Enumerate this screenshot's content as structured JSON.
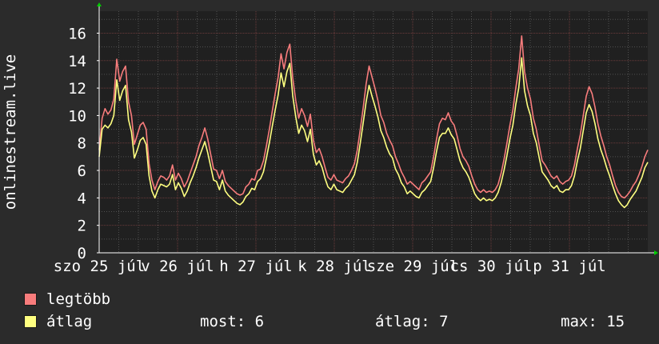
{
  "chart_data": {
    "type": "line",
    "ylabel": "onlinestream.live",
    "ylim": [
      0,
      17.6
    ],
    "yticks": [
      0,
      2,
      4,
      6,
      8,
      10,
      12,
      14,
      16
    ],
    "grid": true,
    "xlabels": [
      "szo 25 júl",
      "v 26 júl",
      "h 27 júl",
      "k 28 júl",
      "sze 29 júl",
      "cs 30 júl",
      "p 31 júl"
    ],
    "days": 7,
    "samples_per_day": 48,
    "series": [
      {
        "name": "legtöbb",
        "color": "#f87c7c",
        "values": [
          7.5,
          9.8,
          10.5,
          10.1,
          10.4,
          11.2,
          14.1,
          12.5,
          13.2,
          13.6,
          11.0,
          10.0,
          7.9,
          8.6,
          9.3,
          9.5,
          9.0,
          6.5,
          5.3,
          4.6,
          5.2,
          5.6,
          5.5,
          5.3,
          5.6,
          6.4,
          5.3,
          5.8,
          5.4,
          4.8,
          5.2,
          5.8,
          6.4,
          7.0,
          7.8,
          8.4,
          9.1,
          8.3,
          7.2,
          6.1,
          6.0,
          5.4,
          6.0,
          5.2,
          4.9,
          4.7,
          4.5,
          4.3,
          4.2,
          4.3,
          4.8,
          5.0,
          5.4,
          5.3,
          6.0,
          6.1,
          6.7,
          7.8,
          9.0,
          10.3,
          11.6,
          12.8,
          14.5,
          13.4,
          14.6,
          15.2,
          12.7,
          11.1,
          9.8,
          10.5,
          10.0,
          9.2,
          10.1,
          8.2,
          7.3,
          7.6,
          7.0,
          6.2,
          5.5,
          5.3,
          5.7,
          5.3,
          5.2,
          5.1,
          5.4,
          5.6,
          6.0,
          6.5,
          7.5,
          9.0,
          10.6,
          12.3,
          13.6,
          12.8,
          12.0,
          11.1,
          10.0,
          9.5,
          8.7,
          8.2,
          7.8,
          7.0,
          6.5,
          5.9,
          5.5,
          5.0,
          5.2,
          5.0,
          4.8,
          4.6,
          5.1,
          5.3,
          5.6,
          5.9,
          7.0,
          8.3,
          9.4,
          9.8,
          9.7,
          10.2,
          9.6,
          9.3,
          8.5,
          7.6,
          7.0,
          6.7,
          6.3,
          5.6,
          5.0,
          4.6,
          4.4,
          4.6,
          4.4,
          4.5,
          4.4,
          4.6,
          5.0,
          5.8,
          6.8,
          8.0,
          9.3,
          10.4,
          12.0,
          13.4,
          15.8,
          13.2,
          12.0,
          11.2,
          9.8,
          9.0,
          7.8,
          6.7,
          6.4,
          6.0,
          5.6,
          5.4,
          5.6,
          5.2,
          5.0,
          5.2,
          5.3,
          5.6,
          6.4,
          7.6,
          8.6,
          10.0,
          11.4,
          12.1,
          11.6,
          10.6,
          9.4,
          8.5,
          7.8,
          7.0,
          6.4,
          5.6,
          4.9,
          4.4,
          4.1,
          4.0,
          4.2,
          4.5,
          4.9,
          5.2,
          5.7,
          6.3,
          7.0,
          7.5
        ]
      },
      {
        "name": "átlag",
        "color": "#ffff80",
        "values": [
          7.0,
          9.0,
          9.3,
          9.1,
          9.4,
          10.0,
          12.6,
          11.1,
          11.8,
          12.2,
          9.7,
          8.8,
          6.9,
          7.5,
          8.2,
          8.4,
          7.9,
          5.6,
          4.5,
          4.0,
          4.6,
          5.0,
          4.9,
          4.8,
          5.0,
          5.7,
          4.6,
          5.1,
          4.7,
          4.1,
          4.5,
          5.1,
          5.6,
          6.2,
          6.9,
          7.5,
          8.1,
          7.3,
          6.3,
          5.3,
          5.2,
          4.6,
          5.3,
          4.5,
          4.2,
          4.0,
          3.8,
          3.6,
          3.5,
          3.7,
          4.1,
          4.3,
          4.7,
          4.6,
          5.2,
          5.4,
          5.9,
          6.9,
          8.0,
          9.2,
          10.4,
          11.5,
          13.1,
          12.1,
          13.2,
          13.8,
          11.4,
          9.9,
          8.7,
          9.3,
          8.9,
          8.1,
          9.0,
          7.2,
          6.4,
          6.7,
          6.2,
          5.4,
          4.8,
          4.6,
          5.0,
          4.6,
          4.5,
          4.4,
          4.7,
          4.9,
          5.3,
          5.7,
          6.6,
          8.0,
          9.5,
          11.0,
          12.2,
          11.4,
          10.7,
          9.9,
          8.9,
          8.4,
          7.7,
          7.2,
          6.9,
          6.1,
          5.7,
          5.1,
          4.8,
          4.3,
          4.5,
          4.3,
          4.1,
          4.0,
          4.4,
          4.6,
          4.9,
          5.2,
          6.2,
          7.4,
          8.4,
          8.7,
          8.7,
          9.1,
          8.6,
          8.3,
          7.5,
          6.7,
          6.2,
          5.9,
          5.5,
          4.9,
          4.3,
          4.0,
          3.8,
          4.0,
          3.8,
          3.9,
          3.8,
          4.0,
          4.4,
          5.1,
          6.0,
          7.1,
          8.3,
          9.3,
          10.8,
          12.0,
          14.2,
          11.8,
          10.7,
          10.0,
          8.7,
          8.0,
          6.9,
          5.9,
          5.6,
          5.3,
          4.9,
          4.7,
          4.9,
          4.5,
          4.4,
          4.6,
          4.6,
          4.9,
          5.6,
          6.7,
          7.6,
          8.9,
          10.2,
          10.8,
          10.3,
          9.4,
          8.3,
          7.5,
          6.9,
          6.2,
          5.6,
          4.9,
          4.3,
          3.8,
          3.5,
          3.3,
          3.5,
          3.9,
          4.2,
          4.5,
          5.0,
          5.5,
          6.2,
          6.6
        ]
      }
    ]
  },
  "legend": {
    "items": [
      {
        "label": "legtöbb",
        "color": "#f87c7c"
      },
      {
        "label": "átlag",
        "color": "#ffff80"
      }
    ],
    "stats": {
      "now": "most: 6",
      "avg": "átlag: 7",
      "max": "max: 15"
    }
  }
}
